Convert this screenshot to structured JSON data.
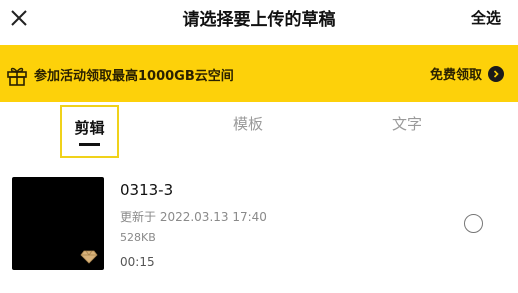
{
  "header": {
    "title": "请选择要上传的草稿",
    "select_all_label": "全选",
    "close_icon": "close-icon"
  },
  "promo": {
    "icon": "gift-icon",
    "text": "参加活动领取最高1000GB云空间",
    "cta_label": "免费领取",
    "cta_icon": "chevron-right-icon",
    "background_color": "#fdd10a"
  },
  "tabs": [
    {
      "label": "剪辑",
      "active": true
    },
    {
      "label": "模板",
      "active": false
    },
    {
      "label": "文字",
      "active": false
    }
  ],
  "drafts": [
    {
      "name": "0313-3",
      "updated": "更新于 2022.03.13 17:40",
      "size": "528KB",
      "duration": "00:15",
      "badge_icon": "diamond-icon",
      "selected": false
    }
  ]
}
